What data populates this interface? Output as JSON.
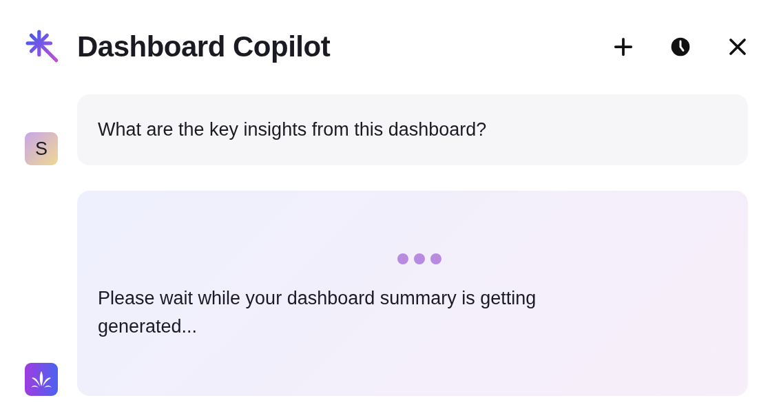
{
  "header": {
    "title": "Dashboard Copilot"
  },
  "messages": [
    {
      "kind": "user",
      "avatar": "S",
      "text": "What are the key insights from this dashboard?"
    },
    {
      "kind": "bot",
      "loading": true,
      "text": "Please wait while your dashboard summary is getting generated..."
    }
  ]
}
